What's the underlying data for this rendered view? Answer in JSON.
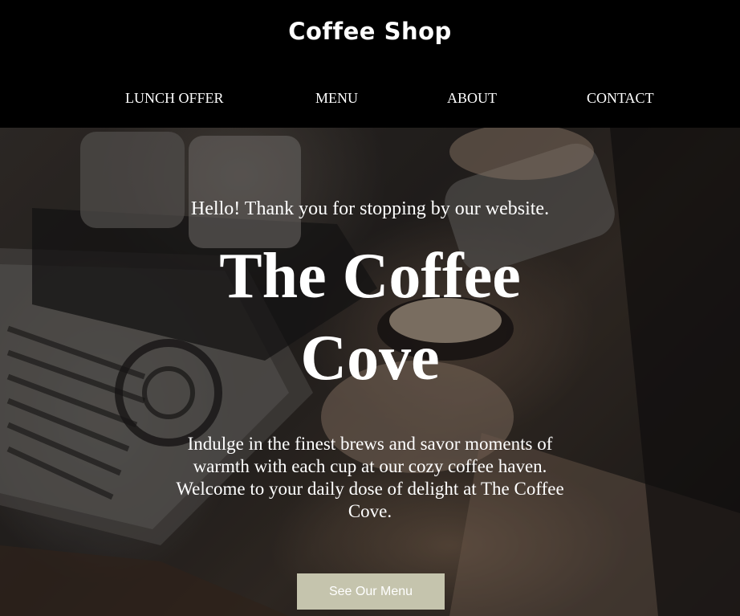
{
  "header": {
    "brand": "Coffee Shop",
    "nav": [
      {
        "label": "LUNCH OFFER"
      },
      {
        "label": "MENU"
      },
      {
        "label": "ABOUT"
      },
      {
        "label": "CONTACT"
      }
    ]
  },
  "hero": {
    "greeting": "Hello! Thank you for stopping by our website.",
    "title": "The Coffee Cove",
    "description": "Indulge in the finest brews and savor moments of warmth with each cup at our cozy coffee haven. Welcome to your daily dose of delight at The Coffee Cove.",
    "cta_label": "See Our Menu",
    "cta_color": "#c5c4ad"
  }
}
